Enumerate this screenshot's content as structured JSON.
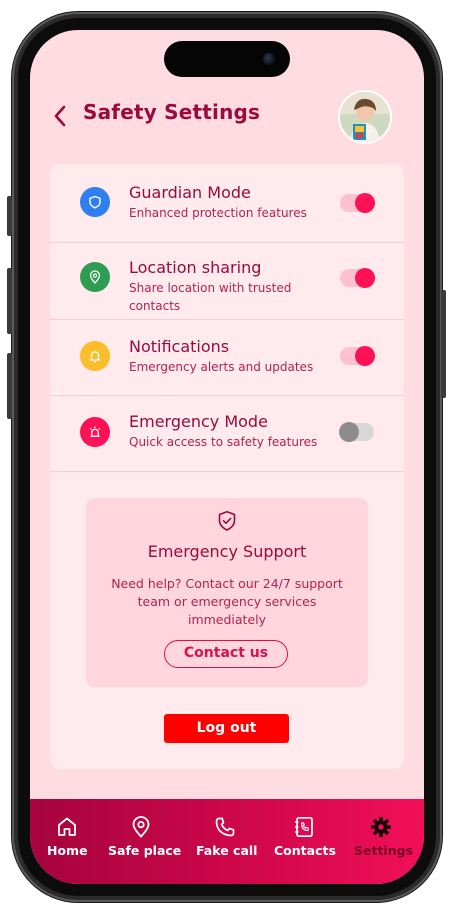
{
  "header": {
    "title": "Safety Settings",
    "back_icon": "chevron-left-icon",
    "avatar_alt": "user profile photo"
  },
  "settings": [
    {
      "id": "guardian",
      "title": "Guardian Mode",
      "subtitle": "Enhanced protection features",
      "icon": "shield-icon",
      "icon_color": "#2f7ff0",
      "enabled": true
    },
    {
      "id": "location",
      "title": "Location sharing",
      "subtitle": "Share location with trusted contacts",
      "icon": "location-pin-icon",
      "icon_color": "#2e9d52",
      "enabled": true
    },
    {
      "id": "notifications",
      "title": "Notifications",
      "subtitle": "Emergency alerts and updates",
      "icon": "bell-icon",
      "icon_color": "#fbbd29",
      "enabled": true
    },
    {
      "id": "emergency",
      "title": "Emergency Mode",
      "subtitle": "Quick access to safety features",
      "icon": "siren-icon",
      "icon_color": "#ff1155",
      "enabled": false
    }
  ],
  "support": {
    "title": "Emergency Support",
    "text": "Need help? Contact our 24/7 support team or emergency services immediately",
    "button": "Contact us",
    "icon": "shield-check-icon"
  },
  "logout_label": "Log out",
  "nav": {
    "items": [
      {
        "label": "Home",
        "icon": "home-icon",
        "active": false
      },
      {
        "label": "Safe place",
        "icon": "location-pin-icon",
        "active": false
      },
      {
        "label": "Fake call",
        "icon": "phone-icon",
        "active": false
      },
      {
        "label": "Contacts",
        "icon": "contacts-book-icon",
        "active": false
      },
      {
        "label": "Settings",
        "icon": "gear-icon",
        "active": true
      }
    ]
  },
  "colors": {
    "accent": "#ff1155",
    "title": "#9a0a3d",
    "screen_bg": "#ffdbe2",
    "logout": "#ff0000"
  }
}
